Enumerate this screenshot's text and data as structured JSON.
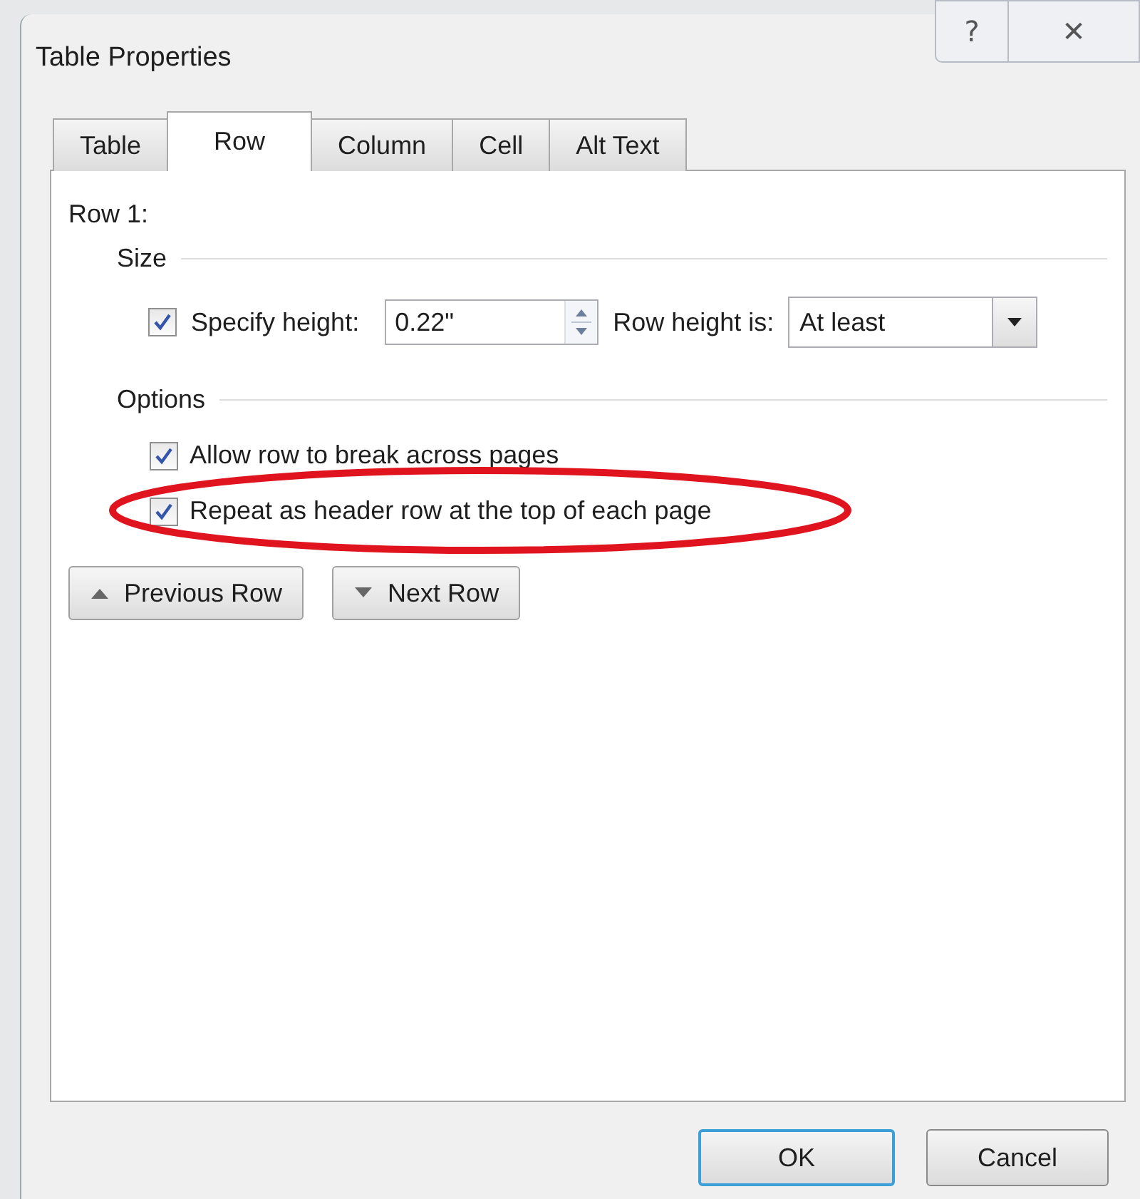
{
  "window": {
    "title": "Table Properties",
    "title_buttons": [
      "?",
      "✕"
    ]
  },
  "tabs": [
    {
      "label": "Table",
      "selected": false
    },
    {
      "label": "Row",
      "selected": true
    },
    {
      "label": "Column",
      "selected": false
    },
    {
      "label": "Cell",
      "selected": false
    },
    {
      "label": "Alt Text",
      "selected": false
    }
  ],
  "row_heading": "Row 1:",
  "size": {
    "heading": "Size",
    "specify_height": {
      "label": "Specify height:",
      "checked": true
    },
    "height_value": "0.22\"",
    "row_height_is_label": "Row height is:",
    "row_height_is_value": "At least"
  },
  "options": {
    "heading": "Options",
    "items": [
      {
        "label": "Allow row to break across pages",
        "checked": true,
        "highlighted": false
      },
      {
        "label": "Repeat as header row at the top of each page",
        "checked": true,
        "highlighted": true
      }
    ]
  },
  "nav_buttons": [
    {
      "label": "Previous Row",
      "kind": "up"
    },
    {
      "label": "Next Row",
      "kind": "down"
    }
  ],
  "buttons": [
    {
      "label": "OK",
      "default": true
    },
    {
      "label": "Cancel",
      "default": false
    }
  ]
}
